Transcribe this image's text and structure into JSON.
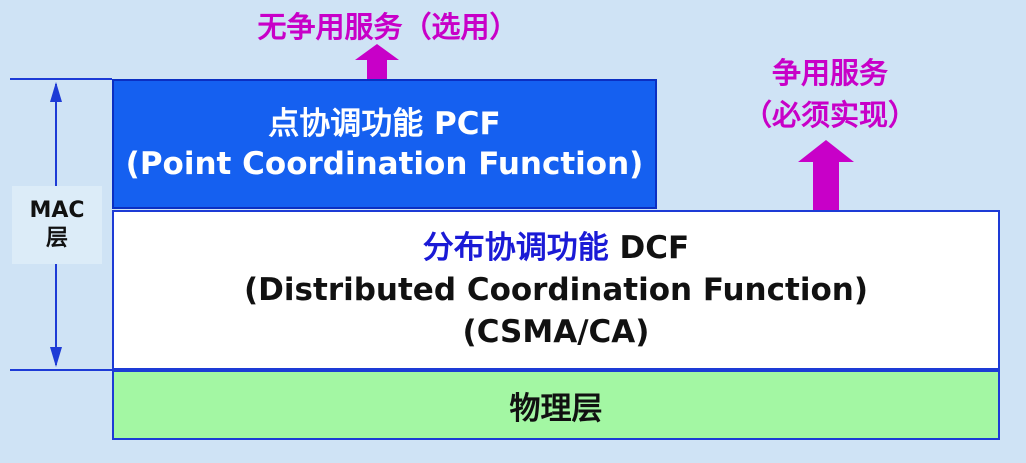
{
  "top_service": {
    "text": "无争用服务（选用）"
  },
  "right_service": {
    "line1": "争用服务",
    "line2": "（必须实现）"
  },
  "pcf": {
    "line1": "点协调功能 PCF",
    "line2": "(Point Coordination Function)"
  },
  "dcf": {
    "cn": "分布协调功能",
    "abbr": " DCF",
    "line2": "(Distributed Coordination Function)",
    "line3": "(CSMA/CA)"
  },
  "physical": {
    "label": "物理层"
  },
  "mac": {
    "line1": "MAC",
    "line2": "层"
  },
  "colors": {
    "background": "#cfe3f5",
    "pcf_fill": "#1560f0",
    "dcf_fill": "#ffffff",
    "physical_fill": "#a3f7a3",
    "arrow": "#c800c8",
    "border": "#1d3bd6"
  }
}
